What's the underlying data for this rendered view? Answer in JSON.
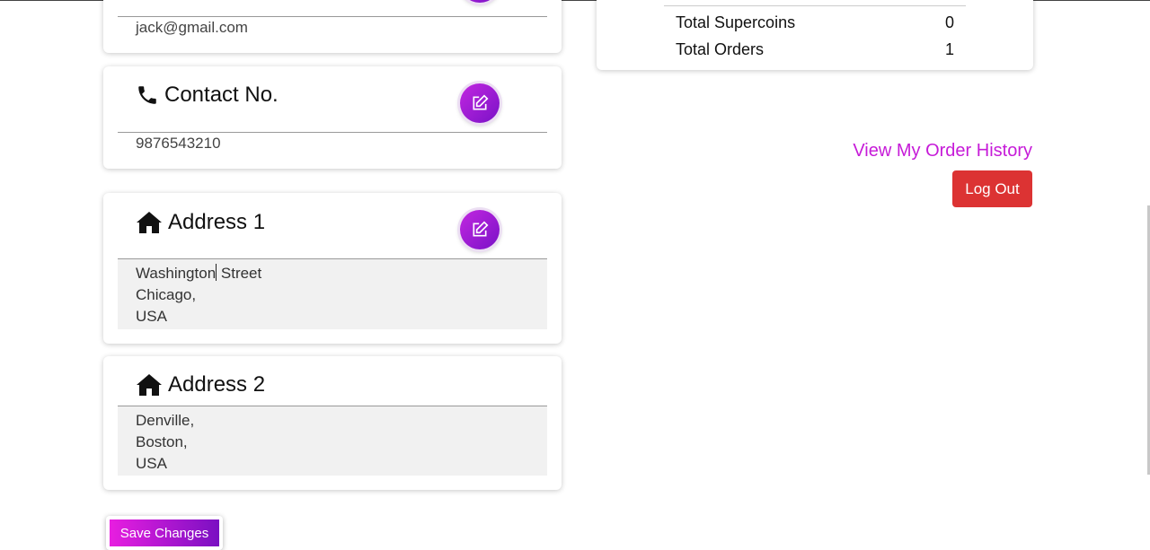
{
  "email": {
    "value": "jack@gmail.com"
  },
  "contact": {
    "title": "Contact No.",
    "value": "9876543210"
  },
  "address1": {
    "title": "Address 1",
    "line1_before_caret": "Washington",
    "line1_after_caret": " Street",
    "line2": "Chicago,",
    "line3": "USA"
  },
  "address2": {
    "title": "Address 2",
    "line1": "Denville,",
    "line2": "Boston,",
    "line3": "USA"
  },
  "stats": {
    "rows": [
      {
        "label": "Total Supercoins",
        "value": "0"
      },
      {
        "label": "Total Orders",
        "value": "1"
      }
    ]
  },
  "actions": {
    "order_history": "View My Order History",
    "logout": "Log Out",
    "save": "Save Changes"
  },
  "icons": {
    "phone": "phone-icon",
    "home": "home-icon",
    "edit": "edit-icon"
  },
  "colors": {
    "accent": "#c61bd8",
    "logout": "#dc3333"
  }
}
